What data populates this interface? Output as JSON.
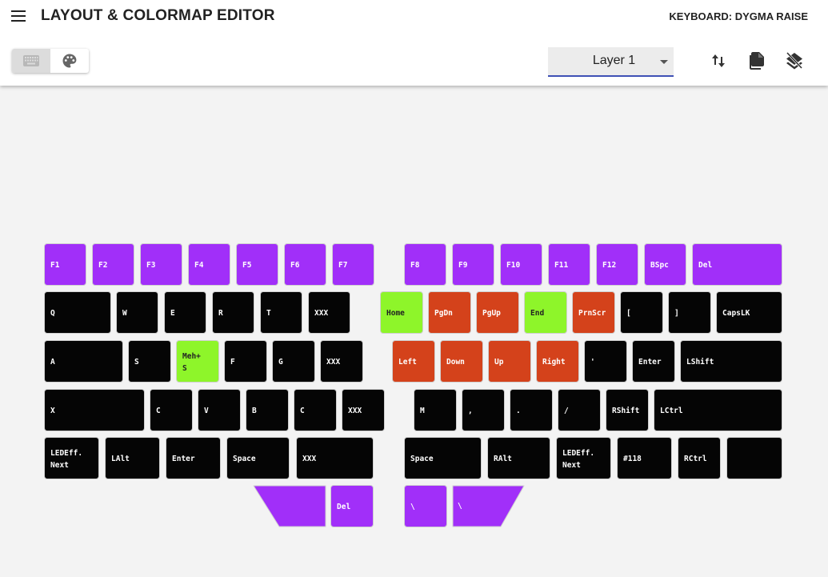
{
  "header": {
    "title": "LAYOUT & COLORMAP EDITOR",
    "keyboard_label": "KEYBOARD: DYGMA RAISE"
  },
  "toolbar": {
    "mode_toggle": [
      {
        "name": "keyboard-icon",
        "mode": "layout",
        "active": true
      },
      {
        "name": "palette-icon",
        "mode": "colormap",
        "active": false
      }
    ],
    "layer": {
      "selected": "Layer 1"
    },
    "tools": [
      {
        "name": "swap-vertical-icon"
      },
      {
        "name": "copy-icon"
      },
      {
        "name": "clear-layer-icon"
      }
    ]
  },
  "colors": {
    "purple": "#a12ff9",
    "green": "#8ef52a",
    "red": "#d4421b",
    "black": "#050505",
    "accent": "#3f51b5"
  },
  "keyboard": {
    "rows": [
      [
        {
          "label": "F1",
          "color": "purple"
        },
        {
          "label": "F2",
          "color": "purple"
        },
        {
          "label": "F3",
          "color": "purple"
        },
        {
          "label": "F4",
          "color": "purple"
        },
        {
          "label": "F5",
          "color": "purple"
        },
        {
          "label": "F6",
          "color": "purple"
        },
        {
          "label": "F7",
          "color": "purple"
        },
        {
          "label": "F8",
          "color": "purple"
        },
        {
          "label": "F9",
          "color": "purple"
        },
        {
          "label": "F10",
          "color": "purple"
        },
        {
          "label": "F11",
          "color": "purple"
        },
        {
          "label": "F12",
          "color": "purple"
        },
        {
          "label": "BSpc",
          "color": "purple"
        },
        {
          "label": "Del",
          "color": "purple"
        }
      ],
      [
        {
          "label": "Q",
          "color": "black"
        },
        {
          "label": "W",
          "color": "black"
        },
        {
          "label": "E",
          "color": "black"
        },
        {
          "label": "R",
          "color": "black"
        },
        {
          "label": "T",
          "color": "black"
        },
        {
          "label": "XXX",
          "color": "black"
        },
        {
          "label": "Home",
          "color": "green"
        },
        {
          "label": "PgDn",
          "color": "red"
        },
        {
          "label": "PgUp",
          "color": "red"
        },
        {
          "label": "End",
          "color": "green"
        },
        {
          "label": "PrnScr",
          "color": "red"
        },
        {
          "label": "[",
          "color": "black"
        },
        {
          "label": "]",
          "color": "black"
        },
        {
          "label": "CapsLK",
          "color": "black"
        }
      ],
      [
        {
          "label": "A",
          "color": "black"
        },
        {
          "label": "S",
          "color": "black"
        },
        {
          "label": "Meh+\nS",
          "color": "green"
        },
        {
          "label": "F",
          "color": "black"
        },
        {
          "label": "G",
          "color": "black"
        },
        {
          "label": "XXX",
          "color": "black"
        },
        {
          "label": "Left",
          "color": "red"
        },
        {
          "label": "Down",
          "color": "red"
        },
        {
          "label": "Up",
          "color": "red"
        },
        {
          "label": "Right",
          "color": "red"
        },
        {
          "label": "'",
          "color": "black"
        },
        {
          "label": "Enter",
          "color": "black"
        },
        {
          "label": "LShift",
          "color": "black"
        }
      ],
      [
        {
          "label": "X",
          "color": "black"
        },
        {
          "label": "C",
          "color": "black"
        },
        {
          "label": "V",
          "color": "black"
        },
        {
          "label": "B",
          "color": "black"
        },
        {
          "label": "C",
          "color": "black"
        },
        {
          "label": "XXX",
          "color": "black"
        },
        {
          "label": "M",
          "color": "black"
        },
        {
          "label": ",",
          "color": "black"
        },
        {
          "label": ".",
          "color": "black"
        },
        {
          "label": "/",
          "color": "black"
        },
        {
          "label": "RShift",
          "color": "black"
        },
        {
          "label": "LCtrl",
          "color": "black"
        }
      ],
      [
        {
          "label": "LEDEff.\nNext",
          "color": "black"
        },
        {
          "label": "LAlt",
          "color": "black"
        },
        {
          "label": "Enter",
          "color": "black"
        },
        {
          "label": "Space",
          "color": "black"
        },
        {
          "label": "XXX",
          "color": "black"
        },
        {
          "label": "Space",
          "color": "black"
        },
        {
          "label": "RAlt",
          "color": "black"
        },
        {
          "label": "LEDEff.\nNext",
          "color": "black"
        },
        {
          "label": "#118",
          "color": "black"
        },
        {
          "label": "RCtrl",
          "color": "black"
        },
        {
          "label": "",
          "color": "black"
        }
      ],
      [
        {
          "label": "",
          "color": "purple"
        },
        {
          "label": "Del",
          "color": "purple"
        },
        {
          "label": "\\",
          "color": "purple"
        },
        {
          "label": "\\",
          "color": "purple"
        }
      ]
    ]
  }
}
